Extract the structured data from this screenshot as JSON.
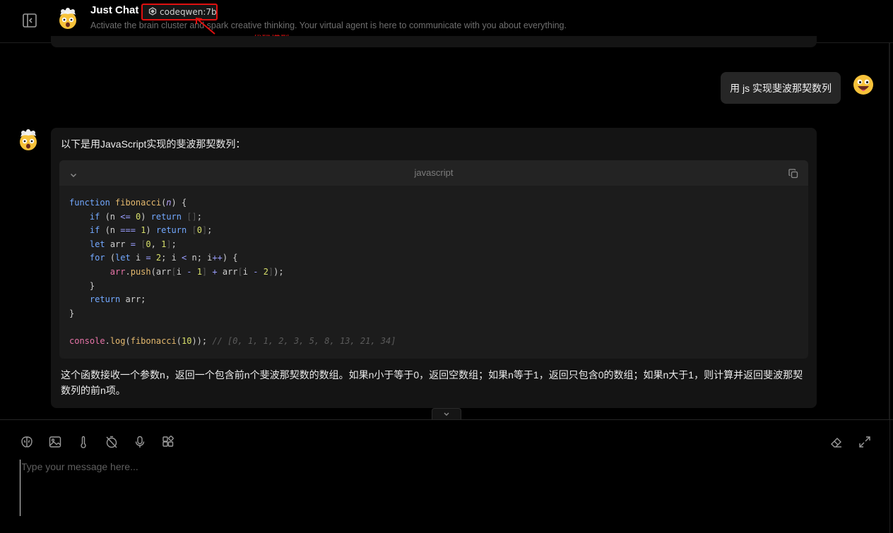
{
  "header": {
    "title": "Just Chat",
    "model_tag": "codeqwen:7b",
    "subtitle": "Activate the brain cluster and spark creative thinking. Your virtual agent is here to communicate with you about everything.",
    "annotation": "Qwen 代码模型"
  },
  "icons": {
    "sidebar_toggle": "sidebar-toggle-icon",
    "agent_avatar": "exploding-head-emoji",
    "user_avatar": "grinning-face-emoji",
    "model": "model-provider-icon",
    "toolbar": [
      "brain-icon",
      "image-icon",
      "thermometer-icon",
      "timer-off-icon",
      "microphone-icon",
      "plugin-grid-icon"
    ],
    "right_tools": [
      "eraser-icon",
      "expand-icon"
    ]
  },
  "messages": {
    "user_text": "用 js 实现斐波那契数列",
    "assistant_intro": "以下是用JavaScript实现的斐波那契数列：",
    "code_language": "javascript",
    "code_lines": [
      "function fibonacci(n) {",
      "    if (n <= 0) return [];",
      "    if (n === 1) return [0];",
      "    let arr = [0, 1];",
      "    for (let i = 2; i < n; i++) {",
      "        arr.push(arr[i - 1] + arr[i - 2]);",
      "    }",
      "    return arr;",
      "}",
      "",
      "console.log(fibonacci(10)); // [0, 1, 1, 2, 3, 5, 8, 13, 21, 34]"
    ],
    "assistant_summary": "这个函数接收一个参数n，返回一个包含前n个斐波那契数的数组。如果n小于等于0，返回空数组；如果n等于1，返回只包含0的数组；如果n大于1，则计算并返回斐波那契数列的前n项。"
  },
  "composer": {
    "placeholder": "Type your message here..."
  },
  "colors": {
    "background": "#000000",
    "bubble": "#141414",
    "user_bubble": "#262626",
    "annotation_red": "#e01010"
  }
}
